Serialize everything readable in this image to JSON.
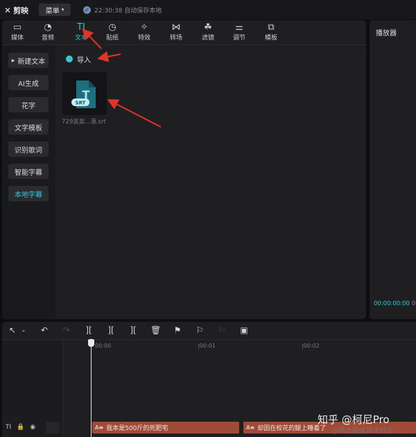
{
  "titlebar": {
    "app_name": "剪映",
    "menu_label": "菜单",
    "save_status": "22:30:38 自动保存本地"
  },
  "tabs": [
    {
      "label": "媒体",
      "icon": "media-icon"
    },
    {
      "label": "音频",
      "icon": "audio-icon"
    },
    {
      "label": "文本",
      "icon": "text-icon",
      "active": true
    },
    {
      "label": "贴纸",
      "icon": "sticker-icon"
    },
    {
      "label": "特效",
      "icon": "effects-icon"
    },
    {
      "label": "转场",
      "icon": "transition-icon"
    },
    {
      "label": "滤镜",
      "icon": "filter-icon"
    },
    {
      "label": "调节",
      "icon": "adjust-icon"
    },
    {
      "label": "模板",
      "icon": "template-icon"
    }
  ],
  "sidebar": {
    "items": [
      {
        "label": "新建文本"
      },
      {
        "label": "AI生成"
      },
      {
        "label": "花字"
      },
      {
        "label": "文字模板"
      },
      {
        "label": "识别歌词"
      },
      {
        "label": "智能字幕"
      },
      {
        "label": "本地字幕",
        "active": true
      }
    ]
  },
  "content": {
    "import_label": "导入",
    "file_badge": "SRT",
    "file_glyph": "T",
    "file_name": "729吴吴...漠.srt"
  },
  "player": {
    "title": "播放器",
    "current_time": "00:00:00:00",
    "total_time_fragment": "0"
  },
  "timeline": {
    "ruler": [
      "00:00",
      "|00:01",
      "|00:02"
    ],
    "track_label": "TI",
    "clips": [
      {
        "badge": "A≡",
        "text": "我本是500斤的死肥宅"
      },
      {
        "badge": "A≡",
        "text": "却因在校花的腿上睡着了"
      }
    ]
  },
  "watermark": {
    "line1": "知乎 @柯尼Pro",
    "line2": "@稀土掘金技术社区"
  },
  "colors": {
    "accent": "#37c6d6",
    "clip": "#a04a38",
    "arrow": "#e2332a"
  }
}
